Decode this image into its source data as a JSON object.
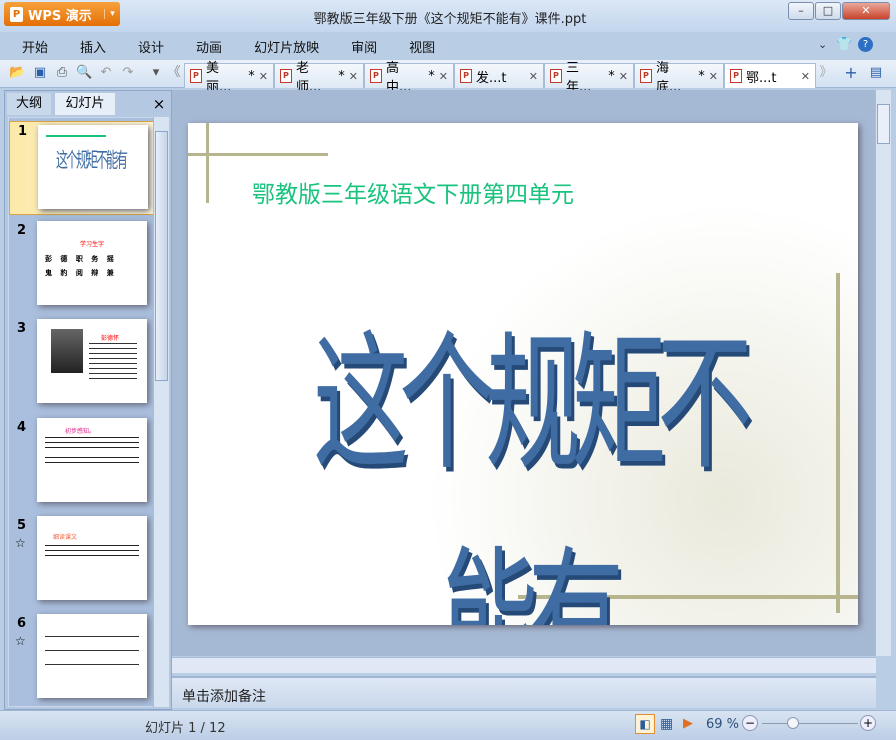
{
  "app": {
    "name": "WPS 演示",
    "title": "鄂教版三年级下册《这个规矩不能有》课件.ppt"
  },
  "menu": [
    "开始",
    "插入",
    "设计",
    "动画",
    "幻灯片放映",
    "审阅",
    "视图"
  ],
  "tabs": [
    {
      "label": "美丽...",
      "mod": "*"
    },
    {
      "label": "老师...",
      "mod": "*"
    },
    {
      "label": "高中...",
      "mod": "*"
    },
    {
      "label": "发...t",
      "mod": ""
    },
    {
      "label": "三年...",
      "mod": "*"
    },
    {
      "label": "海底...",
      "mod": "*"
    },
    {
      "label": "鄂...t",
      "mod": ""
    }
  ],
  "panel": {
    "tab_outline": "大纲",
    "tab_slides": "幻灯片",
    "close": "×"
  },
  "thumbs": [
    {
      "num": "1",
      "title": "这个规矩不能有",
      "star": ""
    },
    {
      "num": "2",
      "title": "学习生字",
      "line1": "彭 德 职 务 摇",
      "line2": "鬼 豹 阅 辩 兼",
      "star": ""
    },
    {
      "num": "3",
      "title": "彭德怀",
      "star": ""
    },
    {
      "num": "4",
      "title": "初步感知。",
      "star": ""
    },
    {
      "num": "5",
      "title": "细读课文",
      "star": "☆"
    },
    {
      "num": "6",
      "title": "",
      "star": "☆"
    }
  ],
  "slide": {
    "subtitle": "鄂教版三年级语文下册第四单元",
    "title": "这个规矩不能有"
  },
  "notes": "单击添加备注",
  "status": {
    "slide": "幻灯片 1 / 12",
    "zoom": "69 %",
    "zoom_value": 69
  }
}
